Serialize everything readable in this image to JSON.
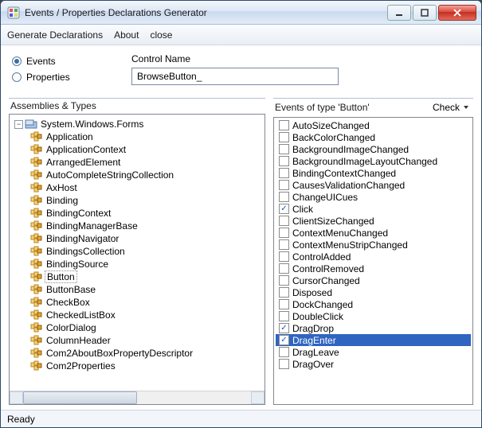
{
  "window": {
    "title": "Events / Properties Declarations Generator"
  },
  "menubar": {
    "generate": "Generate Declarations",
    "about": "About",
    "close": "close"
  },
  "radios": {
    "events": "Events",
    "properties": "Properties",
    "selected": "events"
  },
  "controlName": {
    "label": "Control Name",
    "value": "BrowseButton_"
  },
  "assemblies": {
    "header": "Assemblies & Types",
    "root": "System.Windows.Forms",
    "types": [
      "Application",
      "ApplicationContext",
      "ArrangedElement",
      "AutoCompleteStringCollection",
      "AxHost",
      "Binding",
      "BindingContext",
      "BindingManagerBase",
      "BindingNavigator",
      "BindingsCollection",
      "BindingSource",
      "Button",
      "ButtonBase",
      "CheckBox",
      "CheckedListBox",
      "ColorDialog",
      "ColumnHeader",
      "Com2AboutBoxPropertyDescriptor",
      "Com2Properties"
    ],
    "selected_type": "Button"
  },
  "events": {
    "header": "Events of type 'Button'",
    "check_label": "Check",
    "items": [
      {
        "name": "AutoSizeChanged",
        "checked": false
      },
      {
        "name": "BackColorChanged",
        "checked": false
      },
      {
        "name": "BackgroundImageChanged",
        "checked": false
      },
      {
        "name": "BackgroundImageLayoutChanged",
        "checked": false
      },
      {
        "name": "BindingContextChanged",
        "checked": false
      },
      {
        "name": "CausesValidationChanged",
        "checked": false
      },
      {
        "name": "ChangeUICues",
        "checked": false
      },
      {
        "name": "Click",
        "checked": true
      },
      {
        "name": "ClientSizeChanged",
        "checked": false
      },
      {
        "name": "ContextMenuChanged",
        "checked": false
      },
      {
        "name": "ContextMenuStripChanged",
        "checked": false
      },
      {
        "name": "ControlAdded",
        "checked": false
      },
      {
        "name": "ControlRemoved",
        "checked": false
      },
      {
        "name": "CursorChanged",
        "checked": false
      },
      {
        "name": "Disposed",
        "checked": false
      },
      {
        "name": "DockChanged",
        "checked": false
      },
      {
        "name": "DoubleClick",
        "checked": false
      },
      {
        "name": "DragDrop",
        "checked": true
      },
      {
        "name": "DragEnter",
        "checked": true,
        "selected": true
      },
      {
        "name": "DragLeave",
        "checked": false
      },
      {
        "name": "DragOver",
        "checked": false
      }
    ]
  },
  "status": "Ready",
  "colors": {
    "selection": "#2f64c1",
    "accent": "#3b6ea5",
    "ns_icon_top": "#d6e4f5",
    "ns_icon_bottom": "#a9c4e6",
    "type_icon_a": "#f6d27a",
    "type_icon_b": "#e2a531"
  }
}
